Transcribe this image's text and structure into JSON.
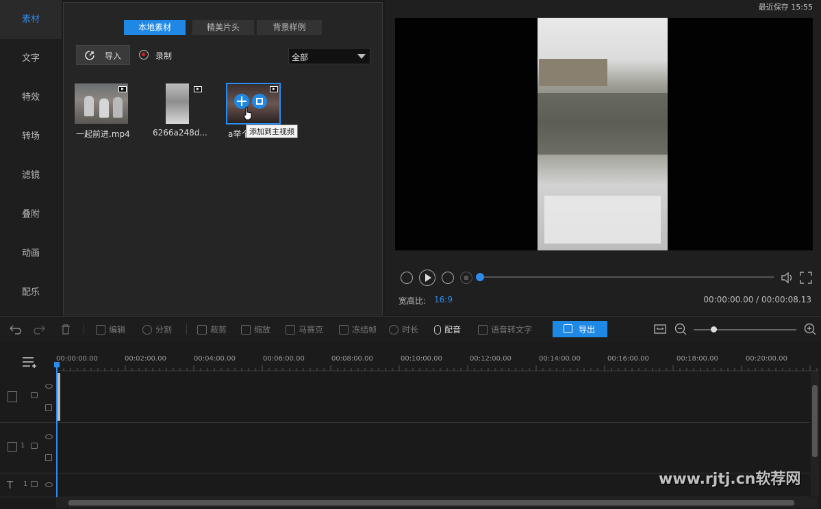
{
  "left_nav": {
    "items": [
      {
        "label": "素材"
      },
      {
        "label": "文字"
      },
      {
        "label": "特效"
      },
      {
        "label": "转场"
      },
      {
        "label": "滤镜"
      },
      {
        "label": "叠附"
      },
      {
        "label": "动画"
      },
      {
        "label": "配乐"
      }
    ]
  },
  "media": {
    "tabs": [
      {
        "label": "本地素材"
      },
      {
        "label": "精美片头"
      },
      {
        "label": "背景样例"
      }
    ],
    "import_label": "导入",
    "record_label": "录制",
    "filter_selected": "全部",
    "items": [
      {
        "name": "一起前进.mp4"
      },
      {
        "name": "6266a248d..."
      },
      {
        "name": "a举个"
      }
    ],
    "tooltip": "添加到主视频"
  },
  "preview": {
    "save_status": "最近保存 15:55",
    "aspect_label": "宽高比:",
    "aspect_value": "16:9",
    "time": "00:00:00.00 / 00:00:08.13",
    "progress": 0
  },
  "toolbar": {
    "edit": "编辑",
    "split": "分割",
    "crop": "裁剪",
    "zoom": "缩放",
    "mosaic": "马赛克",
    "freeze": "冻结帧",
    "duration": "时长",
    "dub": "配音",
    "speech_to_text": "语音转文字",
    "export": "导出"
  },
  "timeline": {
    "ticks": [
      "00:00:00.00",
      "00:02:00.00",
      "00:04:00.00",
      "00:06:00.00",
      "00:08:00.00",
      "00:10:00.00",
      "00:12:00.00",
      "00:14:00.00",
      "00:16:00.00",
      "00:18:00.00",
      "00:20:00.00"
    ],
    "track_pip_num": "1",
    "track_text_num": "1"
  },
  "watermark": "www.rjtj.cn软荐网",
  "colors": {
    "accent": "#1f88e5",
    "record": "#e02020"
  }
}
